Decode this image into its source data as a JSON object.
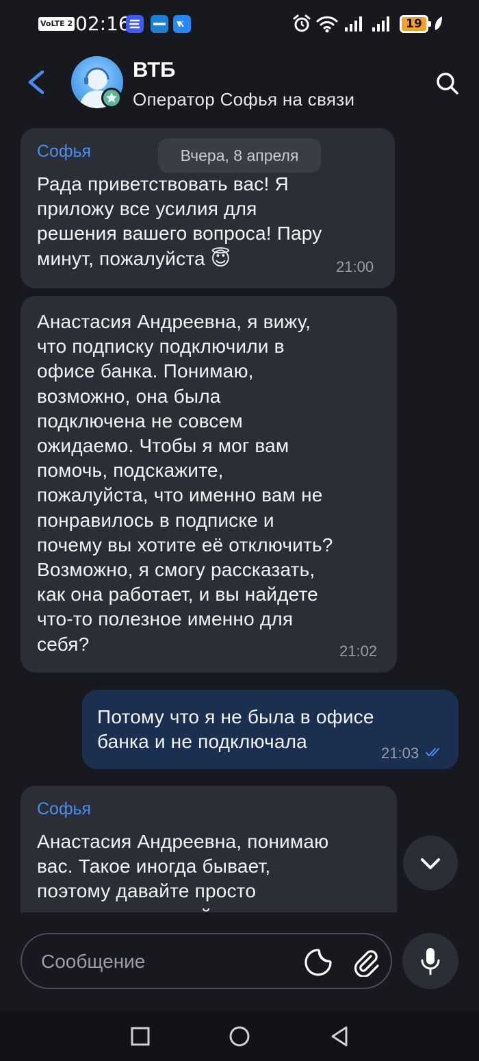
{
  "status_bar": {
    "network_badge": "VoLTE 2",
    "time": "02:16",
    "battery": "19",
    "icons": [
      "app-icon-blue",
      "app-icon-onecity",
      "vk-icon",
      "alarm-icon",
      "wifi-icon",
      "signal-icon",
      "signal-icon",
      "battery-icon",
      "leaf-icon"
    ]
  },
  "header": {
    "title": "ВТБ",
    "subtitle": "Оператор Софья на связи",
    "icons": [
      "back-arrow-icon",
      "operator-avatar",
      "search-icon"
    ]
  },
  "chat": {
    "date_separator": "Вчера, 8 апреля",
    "messages": [
      {
        "direction": "incoming",
        "sender": "Софья",
        "lines": [
          "Рада приветствовать вас! Я",
          "приложу все усилия для",
          "решения вашего вопроса! Пару",
          "минут, пожалуйста 😇"
        ],
        "time": "21:00"
      },
      {
        "direction": "incoming",
        "sender": "",
        "lines": [
          "Анастасия Андреевна, я вижу,",
          "что подписку подключили в",
          "офисе банка. Понимаю,",
          "возможно, она была",
          "подключена не совсем",
          "ожидаемо. Чтобы я мог вам",
          "помочь, подскажите,",
          "пожалуйста, что именно вам не",
          "понравилось в подписке и",
          "почему вы хотите её отключить?",
          "Возможно, я смогу рассказать,",
          "как она работает, и вы найдете",
          "что-то полезное именно для",
          "себя?"
        ],
        "time": "21:02"
      },
      {
        "direction": "outgoing",
        "sender": "",
        "lines": [
          "Потому что я не была в офисе",
          "банка и не подключала"
        ],
        "time": "21:03",
        "status": "read-double-check"
      },
      {
        "direction": "incoming",
        "sender": "Софья",
        "lines": [
          "Анастасия Андреевна, понимаю",
          "вас. Такое иногда бывает,",
          "поэтому давайте просто",
          "посмотрим, как сейчас"
        ],
        "time": ""
      }
    ]
  },
  "composer": {
    "placeholder": "Сообщение",
    "icons": [
      "sticker-icon",
      "paperclip-icon",
      "microphone-icon",
      "chevron-down-icon"
    ]
  },
  "navbar": {
    "icons": [
      "recent-apps-icon",
      "home-icon",
      "back-triangle-icon"
    ]
  },
  "colors": {
    "background": "#17191f",
    "incoming_bubble": "#2b2e35",
    "outgoing_bubble": "#1b3050",
    "accent": "#4a8df0",
    "time_text": "#9a9da6"
  }
}
